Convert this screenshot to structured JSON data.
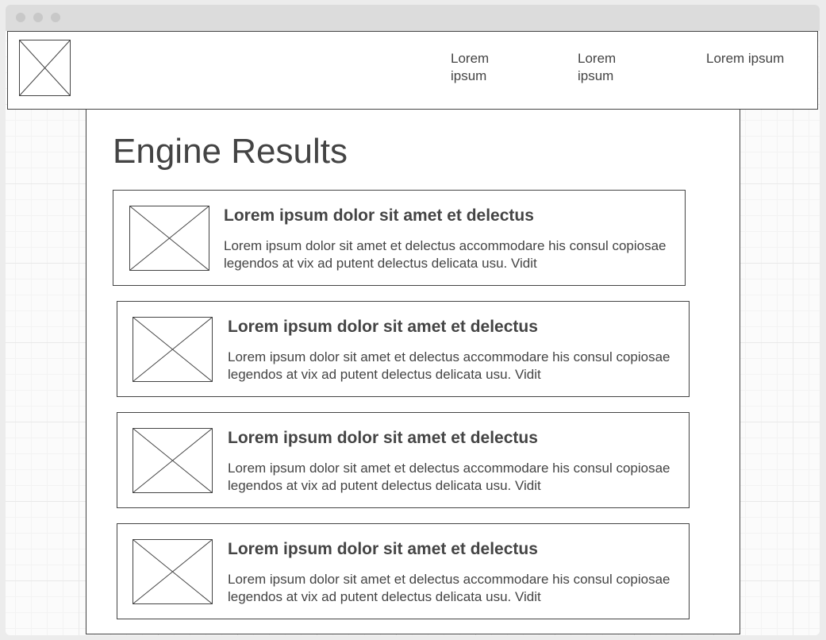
{
  "header": {
    "logo_icon": "image-placeholder-icon",
    "nav": [
      {
        "label": "Lorem ipsum"
      },
      {
        "label": "Lorem ipsum"
      },
      {
        "label": "Lorem ipsum"
      }
    ]
  },
  "page": {
    "title": "Engine Results"
  },
  "results": [
    {
      "thumb_icon": "image-placeholder-icon",
      "title": "Lorem ipsum dolor sit amet et delectus",
      "text": "Lorem ipsum dolor sit amet et delectus accommodare his consul copiosae legendos at vix ad putent delectus delicata usu. Vidit"
    },
    {
      "thumb_icon": "image-placeholder-icon",
      "title": "Lorem ipsum dolor sit amet et delectus",
      "text": "Lorem ipsum dolor sit amet et delectus accommodare his consul copiosae legendos at vix ad putent delectus delicata usu. Vidit"
    },
    {
      "thumb_icon": "image-placeholder-icon",
      "title": "Lorem ipsum dolor sit amet et delectus",
      "text": "Lorem ipsum dolor sit amet et delectus accommodare his consul copiosae legendos at vix ad putent delectus delicata usu. Vidit"
    },
    {
      "thumb_icon": "image-placeholder-icon",
      "title": "Lorem ipsum dolor sit amet et delectus",
      "text": "Lorem ipsum dolor sit amet et delectus accommodare his consul copiosae legendos at vix ad putent delectus delicata usu. Vidit"
    }
  ]
}
